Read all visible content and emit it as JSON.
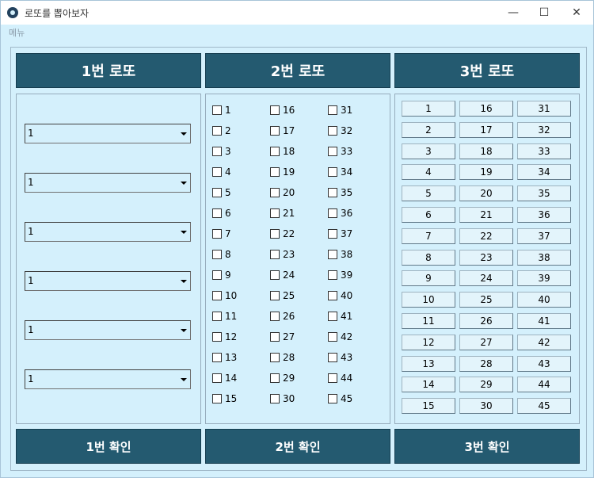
{
  "window": {
    "title": "로또를 뽑아보자",
    "minimize": "—",
    "maximize": "☐",
    "close": "✕"
  },
  "menu": {
    "label": "메뉴"
  },
  "headers": [
    "1번 로또",
    "2번 로또",
    "3번 로또"
  ],
  "confirm_buttons": [
    "1번 확인",
    "2번 확인",
    "3번 확인"
  ],
  "combos": [
    "1",
    "1",
    "1",
    "1",
    "1",
    "1"
  ],
  "numbers": [
    "1",
    "2",
    "3",
    "4",
    "5",
    "6",
    "7",
    "8",
    "9",
    "10",
    "11",
    "12",
    "13",
    "14",
    "15",
    "16",
    "17",
    "18",
    "19",
    "20",
    "21",
    "22",
    "23",
    "24",
    "25",
    "26",
    "27",
    "28",
    "29",
    "30",
    "31",
    "32",
    "33",
    "34",
    "35",
    "36",
    "37",
    "38",
    "39",
    "40",
    "41",
    "42",
    "43",
    "44",
    "45"
  ]
}
